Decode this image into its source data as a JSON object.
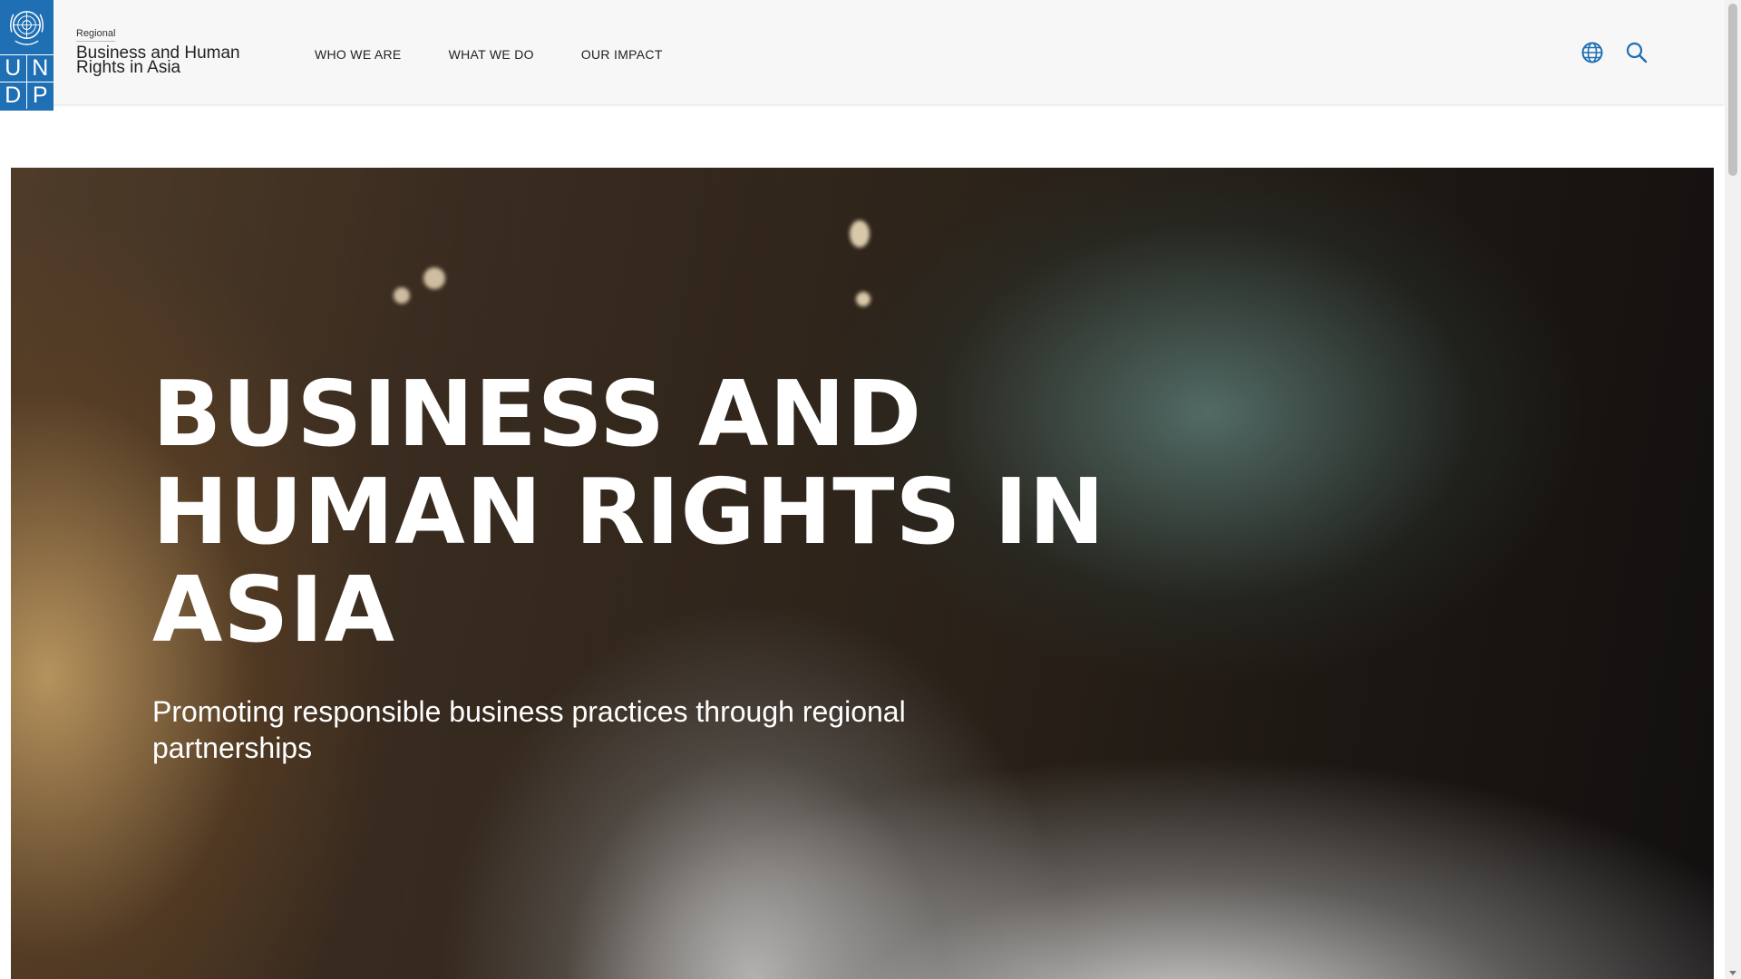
{
  "header": {
    "logo": {
      "emblem_icon": "un-emblem-icon",
      "letters": [
        "U",
        "N",
        "D",
        "P"
      ]
    },
    "kicker": "Regional",
    "site_title": "Business and Human Rights in Asia",
    "nav": [
      {
        "label": "WHO WE ARE"
      },
      {
        "label": "WHAT WE DO"
      },
      {
        "label": "OUR IMPACT"
      }
    ],
    "icons": {
      "language": "globe-icon",
      "search": "search-icon"
    }
  },
  "hero": {
    "title": "BUSINESS AND HUMAN RIGHTS IN ASIA",
    "subtitle": "Promoting responsible business practices through regional partnerships"
  },
  "colors": {
    "brand_blue": "#1f6fb4",
    "header_bg": "#f7f7f7",
    "hero_text": "#ffffff"
  }
}
